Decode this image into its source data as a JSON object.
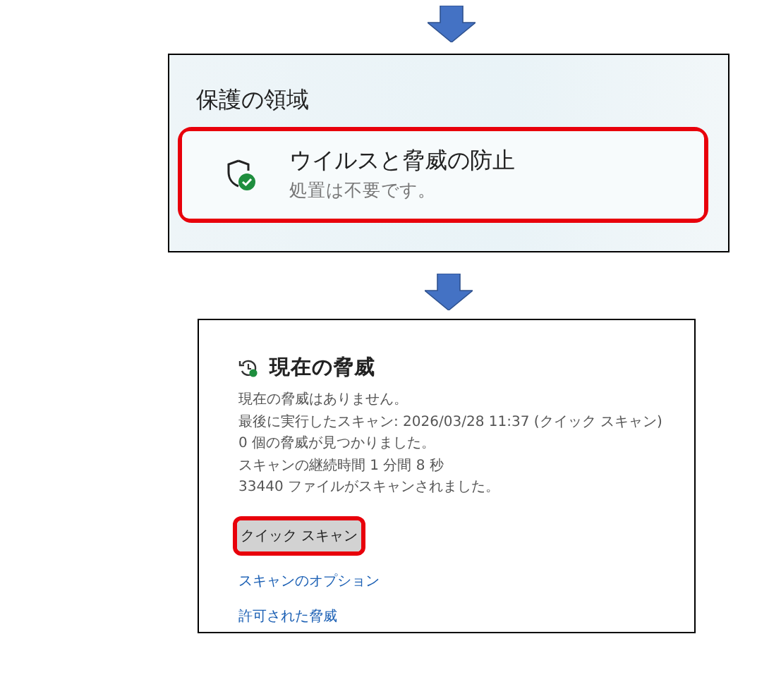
{
  "protection_panel": {
    "heading": "保護の領域",
    "card": {
      "title": "ウイルスと脅威の防止",
      "subtitle": "処置は不要です。",
      "highlighted": true
    }
  },
  "threats_panel": {
    "title": "現在の脅威",
    "lines": [
      "現在の脅威はありません。",
      "最後に実行したスキャン: 2026/03/28 11:37 (クイック スキャン)",
      "0 個の脅威が見つかりました。",
      "スキャンの継続時間 1 分間 8 秒",
      "33440 ファイルがスキャンされました。"
    ],
    "button": {
      "label": "クイック スキャン",
      "highlighted": true
    },
    "links": [
      "スキャンのオプション",
      "許可された脅威"
    ]
  }
}
